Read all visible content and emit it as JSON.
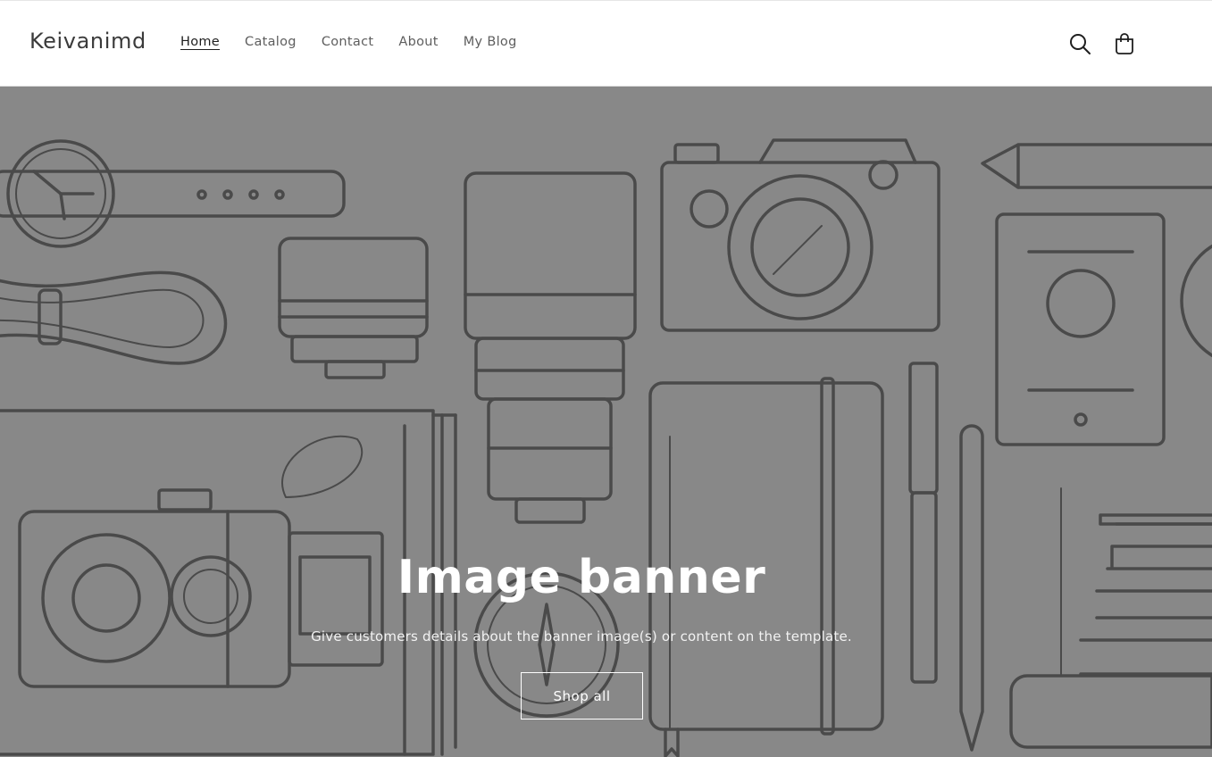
{
  "header": {
    "logo": "Keivanimd",
    "nav": [
      {
        "label": "Home",
        "active": true
      },
      {
        "label": "Catalog",
        "active": false
      },
      {
        "label": "Contact",
        "active": false
      },
      {
        "label": "About",
        "active": false
      },
      {
        "label": "My Blog",
        "active": false
      }
    ],
    "icons": [
      "search-icon",
      "cart-icon"
    ]
  },
  "banner": {
    "title": "Image banner",
    "text": "Give customers details about the banner image(s) or content on the template.",
    "button_label": "Shop all",
    "background_color": "#888888",
    "line_color": "#4a4a4a"
  }
}
